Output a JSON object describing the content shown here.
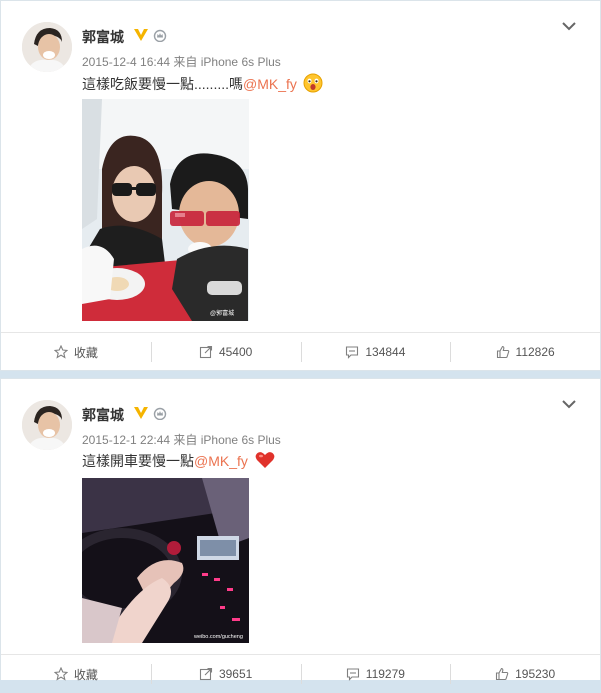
{
  "posts": [
    {
      "username": "郭富城",
      "meta": "2015-12-4 16:44 来自 iPhone 6s Plus",
      "text": "這樣吃飯要慢一點.........嗎",
      "mention": "@MK_fy",
      "emoji": "surprised-face",
      "watermark": "@郭富城",
      "actions": {
        "favorite": "收藏",
        "forward": "45400",
        "comment": "134844",
        "like": "112826"
      }
    },
    {
      "username": "郭富城",
      "meta": "2015-12-1 22:44 来自 iPhone 6s Plus",
      "text": "這樣開車要慢一點",
      "mention": "@MK_fy",
      "emoji": "red-heart",
      "watermark": "weibo.com/gucheng",
      "actions": {
        "favorite": "收藏",
        "forward": "39651",
        "comment": "119279",
        "like": "195230"
      }
    }
  ],
  "colors": {
    "mention": "#eb7350",
    "verified": "#f5b400",
    "page_bg": "#d4e3ee"
  }
}
